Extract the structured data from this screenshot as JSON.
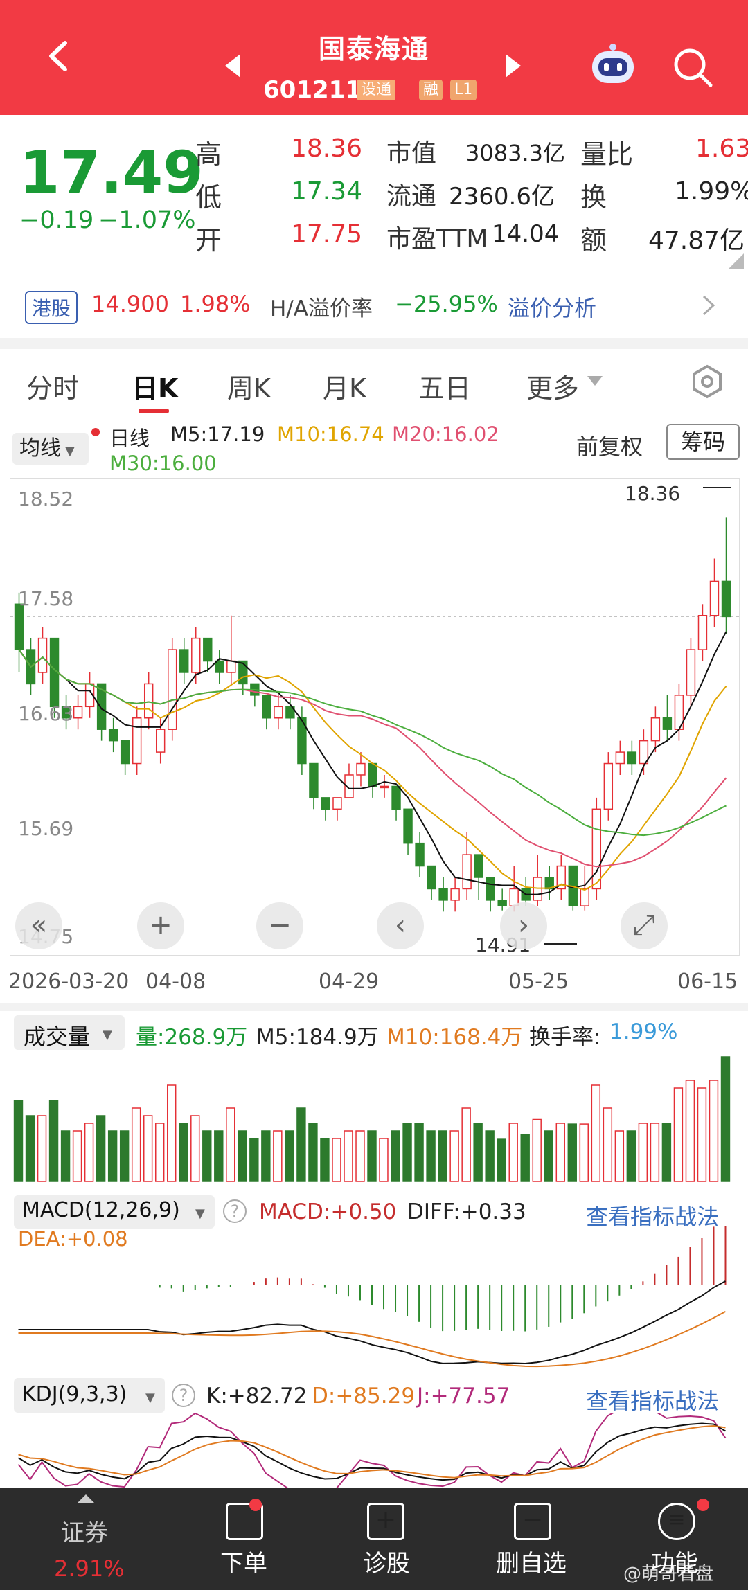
{
  "header": {
    "title": "国泰海通",
    "code": "601211",
    "tags": [
      "设通",
      "融",
      "L1"
    ]
  },
  "quote": {
    "price": "17.49",
    "change": "−0.19",
    "change_pct": "−1.07%",
    "rows": [
      {
        "l1": "高",
        "v1": "18.36",
        "l2": "市值",
        "v2": "3083.3亿",
        "l3": "量比",
        "v3": "1.63"
      },
      {
        "l1": "低",
        "v1": "17.34",
        "l2": "流通",
        "v2": "2360.6亿",
        "l3": "换",
        "v3": "1.99%"
      },
      {
        "l1": "开",
        "v1": "17.75",
        "l2": "市盈TTM",
        "v2": "14.04",
        "l3": "额",
        "v3": "47.87亿"
      }
    ]
  },
  "hk": {
    "tag": "港股",
    "price": "14.900",
    "pct": "1.98%",
    "premium_label": "H/A溢价率",
    "premium": "−25.95%",
    "analysis": "溢价分析"
  },
  "tabs": [
    "分时",
    "日K",
    "周K",
    "月K",
    "五日",
    "更多"
  ],
  "ma": {
    "btn": "均线",
    "day": "日线",
    "m5": "M5:17.19",
    "m10": "M10:16.74",
    "m20": "M20:16.02",
    "m30": "M30:16.00",
    "fuquan": "前复权",
    "chouma": "筹码"
  },
  "price_axis": [
    "18.52",
    "17.58",
    "16.63",
    "15.69",
    "14.75"
  ],
  "date_axis": [
    "2026-03-20",
    "04-08",
    "04-29",
    "05-25",
    "06-15"
  ],
  "annotations": {
    "high": "18.36",
    "low": "14.91"
  },
  "volume": {
    "label": "成交量",
    "vol": "量:268.9万",
    "m5": "M5:184.9万",
    "m10": "M10:168.4万",
    "turnover_label": "换手率:",
    "turnover": "1.99%"
  },
  "macd": {
    "label": "MACD(12,26,9)",
    "macd": "MACD:+0.50",
    "diff": "DIFF:+0.33",
    "dea": "DEA:+0.08",
    "link": "查看指标战法"
  },
  "kdj": {
    "label": "KDJ(9,3,3)",
    "k": "K:+82.72",
    "d": "D:+85.29",
    "j": "J:+77.57",
    "link": "查看指标战法"
  },
  "bottom_nav": [
    {
      "label": "证券",
      "sub": "2.91%"
    },
    {
      "label": "下单"
    },
    {
      "label": "诊股"
    },
    {
      "label": "删自选"
    },
    {
      "label": "功能"
    }
  ],
  "watermark": "@萌哥看盘",
  "colors": {
    "header": "#f23a44",
    "up": "#e52f35",
    "down": "#1a9a35",
    "link": "#3a6fc0"
  },
  "chart_data": {
    "type": "candlestick",
    "ylim": [
      14.75,
      18.52
    ],
    "candles": [
      [
        17.6,
        17.2,
        17.7,
        17.0
      ],
      [
        17.2,
        16.9,
        17.3,
        16.8
      ],
      [
        17.0,
        17.3,
        17.4,
        16.9
      ],
      [
        17.3,
        16.7,
        17.3,
        16.6
      ],
      [
        16.7,
        16.6,
        16.8,
        16.5
      ],
      [
        16.6,
        16.7,
        16.8,
        16.5
      ],
      [
        16.7,
        16.9,
        17.0,
        16.6
      ],
      [
        16.9,
        16.5,
        16.9,
        16.4
      ],
      [
        16.5,
        16.4,
        16.6,
        16.3
      ],
      [
        16.4,
        16.2,
        16.4,
        16.1
      ],
      [
        16.2,
        16.6,
        16.7,
        16.1
      ],
      [
        16.6,
        16.9,
        17.0,
        16.5
      ],
      [
        16.3,
        16.5,
        16.6,
        16.2
      ],
      [
        16.5,
        17.2,
        17.3,
        16.4
      ],
      [
        17.2,
        17.0,
        17.3,
        16.9
      ],
      [
        17.0,
        17.3,
        17.4,
        16.9
      ],
      [
        17.3,
        17.1,
        17.3,
        17.0
      ],
      [
        17.1,
        17.0,
        17.2,
        16.9
      ],
      [
        17.0,
        17.1,
        17.5,
        16.9
      ],
      [
        17.1,
        16.9,
        17.1,
        16.8
      ],
      [
        16.9,
        16.8,
        16.9,
        16.7
      ],
      [
        16.8,
        16.6,
        16.8,
        16.5
      ],
      [
        16.6,
        16.7,
        16.8,
        16.5
      ],
      [
        16.7,
        16.6,
        16.8,
        16.5
      ],
      [
        16.6,
        16.2,
        16.7,
        16.1
      ],
      [
        16.2,
        15.9,
        16.2,
        15.8
      ],
      [
        15.9,
        15.8,
        15.9,
        15.7
      ],
      [
        15.8,
        15.9,
        15.9,
        15.7
      ],
      [
        15.9,
        16.1,
        16.2,
        15.9
      ],
      [
        16.1,
        16.2,
        16.3,
        16.0
      ],
      [
        16.2,
        16.0,
        16.2,
        15.9
      ],
      [
        16.0,
        16.0,
        16.1,
        15.9
      ],
      [
        16.0,
        15.8,
        16.0,
        15.7
      ],
      [
        15.8,
        15.5,
        15.8,
        15.4
      ],
      [
        15.5,
        15.3,
        15.6,
        15.2
      ],
      [
        15.3,
        15.1,
        15.3,
        15.0
      ],
      [
        15.1,
        15.0,
        15.2,
        14.9
      ],
      [
        15.0,
        15.1,
        15.2,
        14.9
      ],
      [
        15.1,
        15.4,
        15.6,
        15.0
      ],
      [
        15.4,
        15.2,
        15.4,
        15.0
      ],
      [
        15.2,
        15.0,
        15.2,
        14.9
      ],
      [
        15.0,
        14.95,
        15.1,
        14.91
      ],
      [
        14.95,
        15.1,
        15.3,
        14.9
      ],
      [
        15.1,
        15.0,
        15.2,
        14.95
      ],
      [
        15.0,
        15.2,
        15.4,
        14.95
      ],
      [
        15.2,
        15.1,
        15.3,
        15.0
      ],
      [
        15.1,
        15.3,
        15.4,
        15.0
      ],
      [
        15.3,
        14.95,
        15.3,
        14.91
      ],
      [
        14.95,
        15.1,
        15.3,
        14.91
      ],
      [
        15.1,
        15.8,
        15.9,
        15.0
      ],
      [
        15.8,
        16.2,
        16.3,
        15.7
      ],
      [
        16.2,
        16.3,
        16.4,
        16.1
      ],
      [
        16.3,
        16.2,
        16.4,
        16.1
      ],
      [
        16.2,
        16.4,
        16.5,
        16.1
      ],
      [
        16.4,
        16.6,
        16.7,
        16.3
      ],
      [
        16.6,
        16.5,
        16.8,
        16.4
      ],
      [
        16.5,
        16.8,
        16.9,
        16.4
      ],
      [
        16.8,
        17.2,
        17.3,
        16.7
      ],
      [
        17.2,
        17.5,
        17.6,
        17.1
      ],
      [
        17.5,
        17.8,
        18.0,
        17.4
      ],
      [
        17.8,
        17.49,
        18.36,
        17.34
      ]
    ],
    "ma5_label": "M5",
    "ma10_label": "M10",
    "ma20_label": "M20",
    "ma30_label": "M30"
  }
}
